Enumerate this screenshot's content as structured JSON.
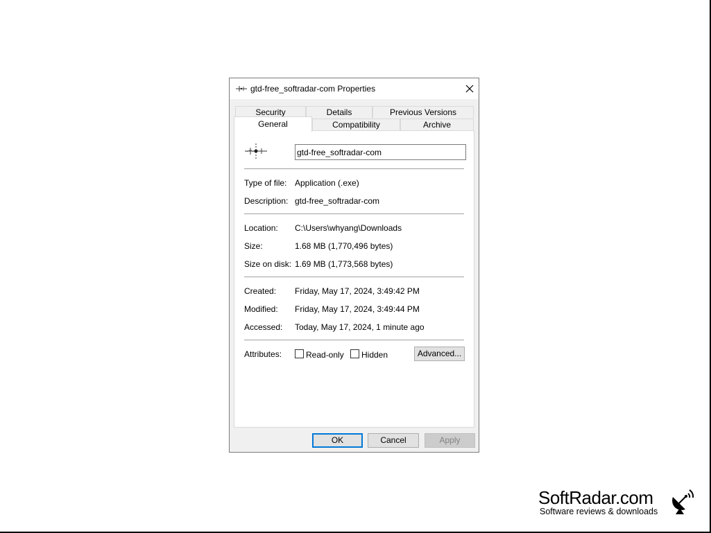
{
  "dialog": {
    "title": "gtd-free_softradar-com Properties"
  },
  "tabs": [
    {
      "label": "Security"
    },
    {
      "label": "Details"
    },
    {
      "label": "Previous Versions"
    },
    {
      "label": "General"
    },
    {
      "label": "Compatibility"
    },
    {
      "label": "Archive"
    }
  ],
  "general": {
    "filename": "gtd-free_softradar-com",
    "rows": [
      {
        "label": "Type of file:",
        "value": "Application (.exe)"
      },
      {
        "label": "Description:",
        "value": "gtd-free_softradar-com"
      },
      {
        "label": "Location:",
        "value": "C:\\Users\\whyang\\Downloads"
      },
      {
        "label": "Size:",
        "value": "1.68 MB (1,770,496 bytes)"
      },
      {
        "label": "Size on disk:",
        "value": "1.69 MB (1,773,568 bytes)"
      },
      {
        "label": "Created:",
        "value": "Friday, May 17, 2024, 3:49:42 PM"
      },
      {
        "label": "Modified:",
        "value": "Friday, May 17, 2024, 3:49:44 PM"
      },
      {
        "label": "Accessed:",
        "value": "Today, May 17, 2024, 1 minute ago"
      }
    ],
    "attributes_label": "Attributes:",
    "readonly_label": "Read-only",
    "hidden_label": "Hidden",
    "advanced_label": "Advanced..."
  },
  "buttons": {
    "ok": "OK",
    "cancel": "Cancel",
    "apply": "Apply"
  },
  "watermark": {
    "name": "SoftRadar.com",
    "tagline": "Software reviews & downloads"
  },
  "colors": {
    "accent": "#0078d7",
    "dialog_bg": "#f0f0f0",
    "panel_bg": "#ffffff"
  }
}
